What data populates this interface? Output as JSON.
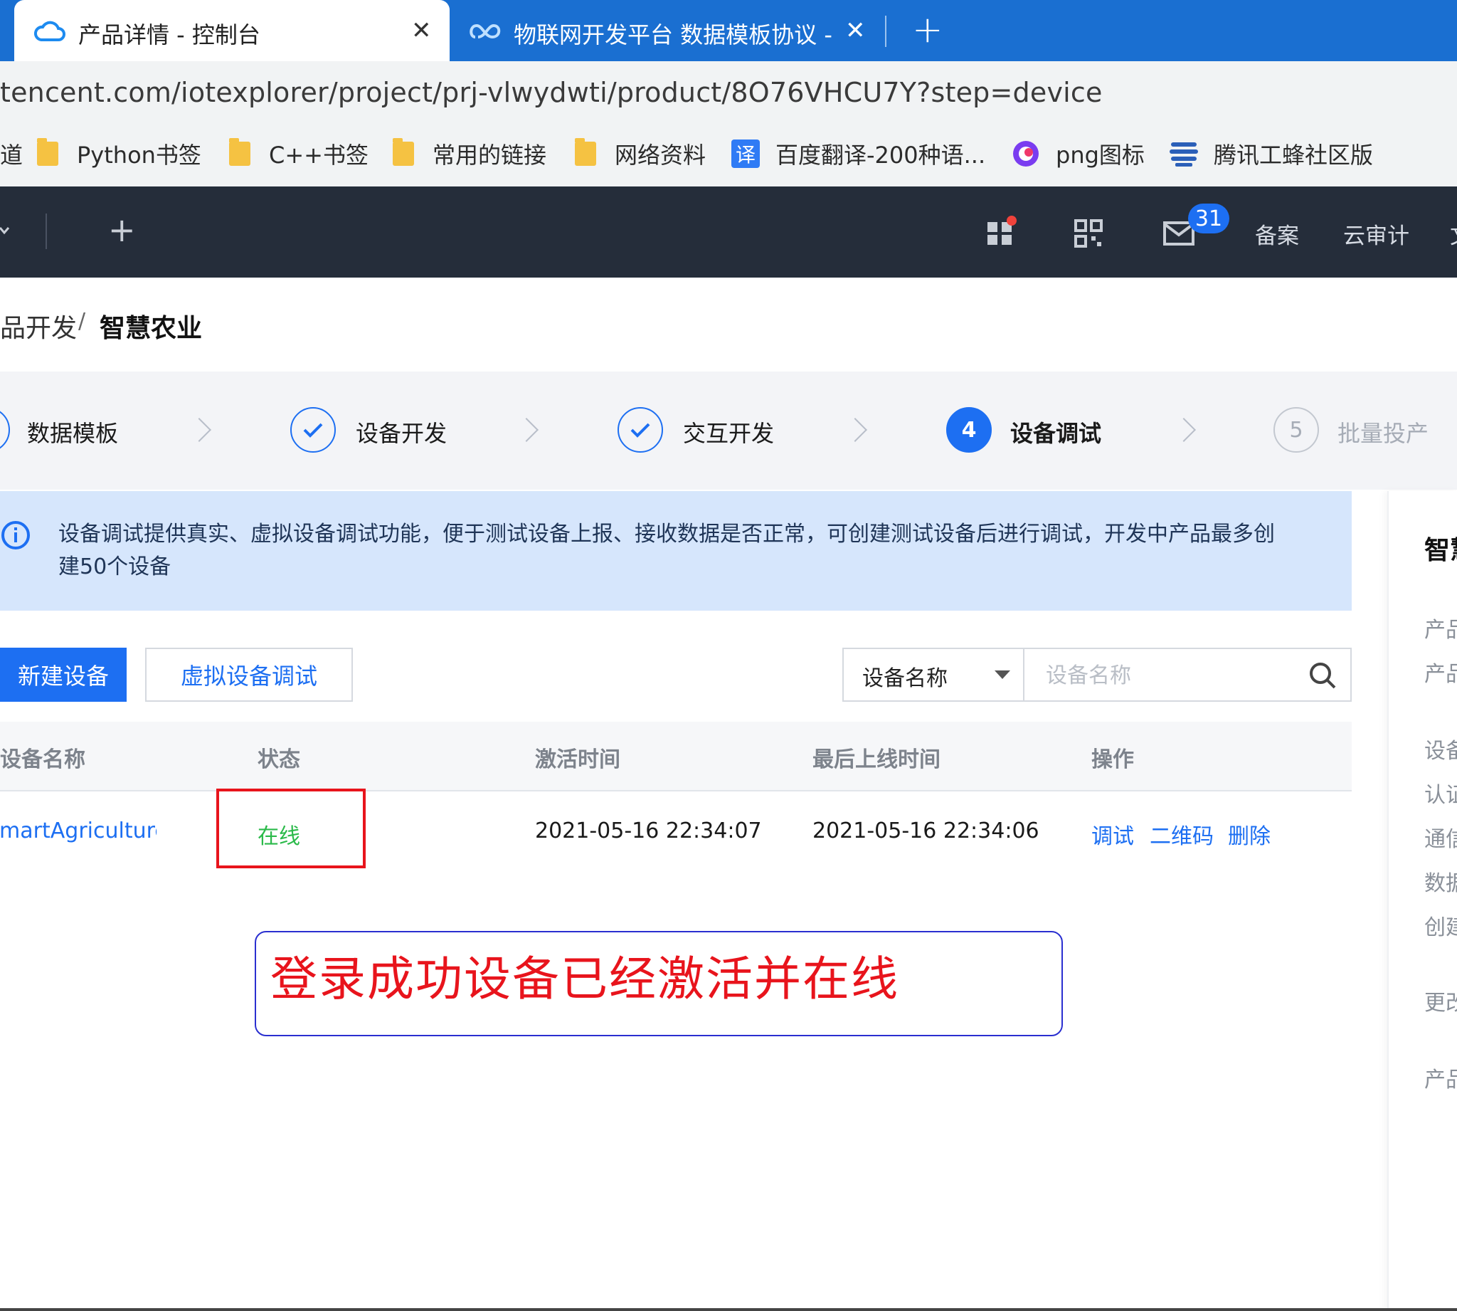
{
  "browser": {
    "tabs": [
      {
        "title": "产品详情 - 控制台",
        "active": true,
        "icon": "cloud-icon"
      },
      {
        "title": "物联网开发平台 数据模板协议 - ",
        "active": false,
        "icon": "iot-cloud-icon"
      }
    ],
    "new_tab_label": "+",
    "close_label": "✕",
    "url": "tencent.com/iotexplorer/project/prj-vlwydwti/product/8O76VHCU7Y?step=device",
    "bookmarks": [
      {
        "label": "道",
        "icon": "folder-icon"
      },
      {
        "label": "Python书签",
        "icon": "folder-icon"
      },
      {
        "label": "C++书签",
        "icon": "folder-icon"
      },
      {
        "label": "常用的链接",
        "icon": "folder-icon"
      },
      {
        "label": "网络资料",
        "icon": "folder-icon"
      },
      {
        "label": "百度翻译-200种语...",
        "icon": "translate-icon",
        "icon_text": "译"
      },
      {
        "label": "png图标",
        "icon": "png-logo-icon"
      },
      {
        "label": "腾讯工蜂社区版",
        "icon": "stack-logo-icon"
      }
    ]
  },
  "console_header": {
    "plus_label": "+",
    "mail_badge": "31",
    "links": [
      "备案",
      "云审计",
      "文"
    ]
  },
  "breadcrumb": {
    "parent": "品开发",
    "separator": "/",
    "current": "智慧农业"
  },
  "steps": [
    {
      "label": "数据模板",
      "status": "done"
    },
    {
      "label": "设备开发",
      "status": "done"
    },
    {
      "label": "交互开发",
      "status": "done"
    },
    {
      "number": "4",
      "label": "设备调试",
      "status": "current"
    },
    {
      "number": "5",
      "label": "批量投产",
      "status": "pending"
    }
  ],
  "banner": {
    "text": "设备调试提供真实、虚拟设备调试功能，便于测试设备上报、接收数据是否正常，可创建测试设备后进行调试，开发中产品最多创建50个设备"
  },
  "toolbar": {
    "new_device": "新建设备",
    "virtual_debug": "虚拟设备调试",
    "filter_select": "设备名称",
    "search_placeholder": "设备名称"
  },
  "table": {
    "headers": [
      "设备名称",
      "状态",
      "激活时间",
      "最后上线时间",
      "操作"
    ],
    "rows": [
      {
        "name": "SmartAgriculture",
        "status": "在线",
        "activated": "2021-05-16 22:34:07",
        "last_online": "2021-05-16 22:34:06",
        "actions": [
          "调试",
          "二维码",
          "删除"
        ]
      }
    ]
  },
  "side_panel": {
    "fragments": [
      "智慧",
      "产品",
      "产品",
      "设备",
      "认证",
      "通信",
      "数据",
      "创建",
      "更改",
      "产品"
    ]
  },
  "annotation": {
    "text": "登录成功设备已经激活并在线"
  },
  "colors": {
    "primary": "#1d6ff2",
    "online": "#2bba4a",
    "annotation_red": "#e8141c",
    "annotation_border": "#2a2fd0",
    "header_dark": "#252d3a",
    "tab_bar": "#1a6fd1",
    "banner_bg": "#d6e6fc"
  }
}
